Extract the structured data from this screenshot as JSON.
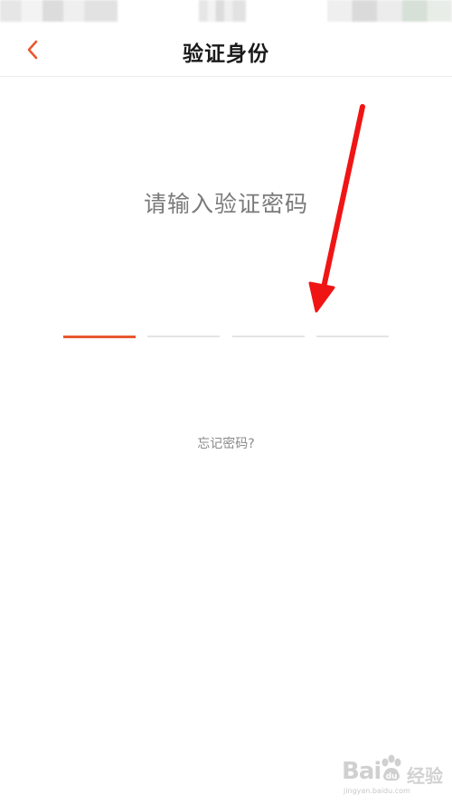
{
  "header": {
    "title": "验证身份",
    "back_icon": "chevron-left-icon"
  },
  "main": {
    "prompt": "请输入验证密码",
    "code_slots": 4,
    "active_slot": 1,
    "forgot_link": "忘记密码?"
  },
  "colors": {
    "accent": "#e8582f",
    "annotation_arrow": "#f01515"
  },
  "watermark": {
    "logo": "Bai",
    "text": "经验",
    "url": "jingyan.baidu.com"
  }
}
